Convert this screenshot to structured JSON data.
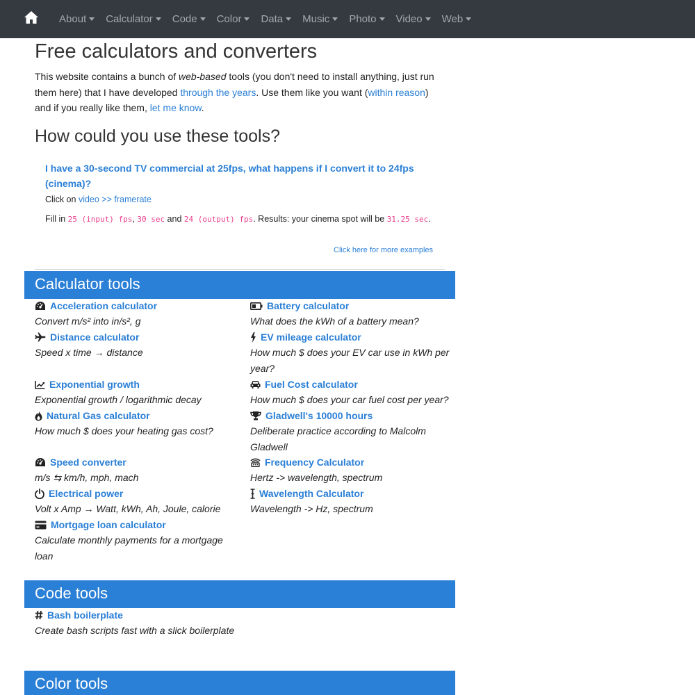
{
  "navbar": {
    "items": [
      {
        "label": "About"
      },
      {
        "label": "Calculator"
      },
      {
        "label": "Code"
      },
      {
        "label": "Color"
      },
      {
        "label": "Data"
      },
      {
        "label": "Music"
      },
      {
        "label": "Photo"
      },
      {
        "label": "Video"
      },
      {
        "label": "Web"
      }
    ]
  },
  "main": {
    "title": "Free calculators and converters",
    "intro": {
      "p1": "This website contains a bunch of ",
      "em": "web-based",
      "p2": " tools (you don't need to install anything, just run them here) that I have developed ",
      "link1": "through the years",
      "p3": ". Use them like you want (",
      "link2": "within reason",
      "p4": ") and if you really like them, ",
      "link3": "let me know",
      "p5": "."
    },
    "howto_title": "How could you use these tools?",
    "example": {
      "question": "I have a 30-second TV commercial at 25fps, what happens if I convert it to 24fps (cinema)?",
      "click_prefix": "Click on ",
      "click_link": "video >> framerate",
      "fill_prefix": "Fill in ",
      "code1": "25 (input) fps",
      "sep1": ", ",
      "code2": "30 sec",
      "sep2": " and ",
      "code3": "24 (output) fps",
      "results": ". Results: your cinema spot will be ",
      "code4": "31.25 sec",
      "end": "."
    },
    "more_examples": "Click here for more examples"
  },
  "sections": {
    "calculator": {
      "title": "Calculator tools",
      "tools": [
        {
          "title": "Acceleration calculator",
          "desc": "Convert m/s² into in/s², g",
          "icon": "tachometer-icon"
        },
        {
          "title": "Battery calculator",
          "desc": "What does the kWh of a battery mean?",
          "icon": "battery-icon"
        },
        {
          "title": "Distance calculator",
          "desc": "Speed x time → distance",
          "icon": "plane-icon"
        },
        {
          "title": "EV mileage calculator",
          "desc": "How much $ does your EV car use in kWh per year?",
          "icon": "bolt-icon"
        },
        {
          "title": "Exponential growth",
          "desc": "Exponential growth / logarithmic decay",
          "icon": "chart-line-icon"
        },
        {
          "title": "Fuel Cost calculator",
          "desc": "How much $ does your car fuel cost per year?",
          "icon": "car-icon"
        },
        {
          "title": "Natural Gas calculator",
          "desc": "How much $ does your heating gas cost?",
          "icon": "fire-icon"
        },
        {
          "title": "Gladwell's 10000 hours",
          "desc": "Deliberate practice according to Malcolm Gladwell",
          "icon": "trophy-icon"
        },
        {
          "title": "Speed converter",
          "desc": "m/s ⇆ km/h, mph, mach",
          "icon": "tachometer-icon"
        },
        {
          "title": "Frequency Calculator",
          "desc": "Hertz -> wavelength, spectrum",
          "icon": "broadcast-icon"
        },
        {
          "title": "Electrical power",
          "desc": "Volt x Amp → Watt, kWh, Ah, Joule, calorie",
          "icon": "power-icon"
        },
        {
          "title": "Wavelength Calculator",
          "desc": "Wavelength -> Hz, spectrum",
          "icon": "i-cursor-icon"
        },
        {
          "title": "Mortgage loan calculator",
          "desc": "Calculate monthly payments for a mortgage loan",
          "icon": "credit-card-icon"
        }
      ]
    },
    "code": {
      "title": "Code tools",
      "tools": [
        {
          "title": "Bash boilerplate",
          "desc": "Create bash scripts fast with a slick boilerplate",
          "icon": "hashtag-icon"
        }
      ]
    },
    "color": {
      "title": "Color tools"
    }
  },
  "colors": {
    "navbar_bg": "#343a40",
    "accent": "#2a7fd6",
    "code": "#e83e8c"
  }
}
